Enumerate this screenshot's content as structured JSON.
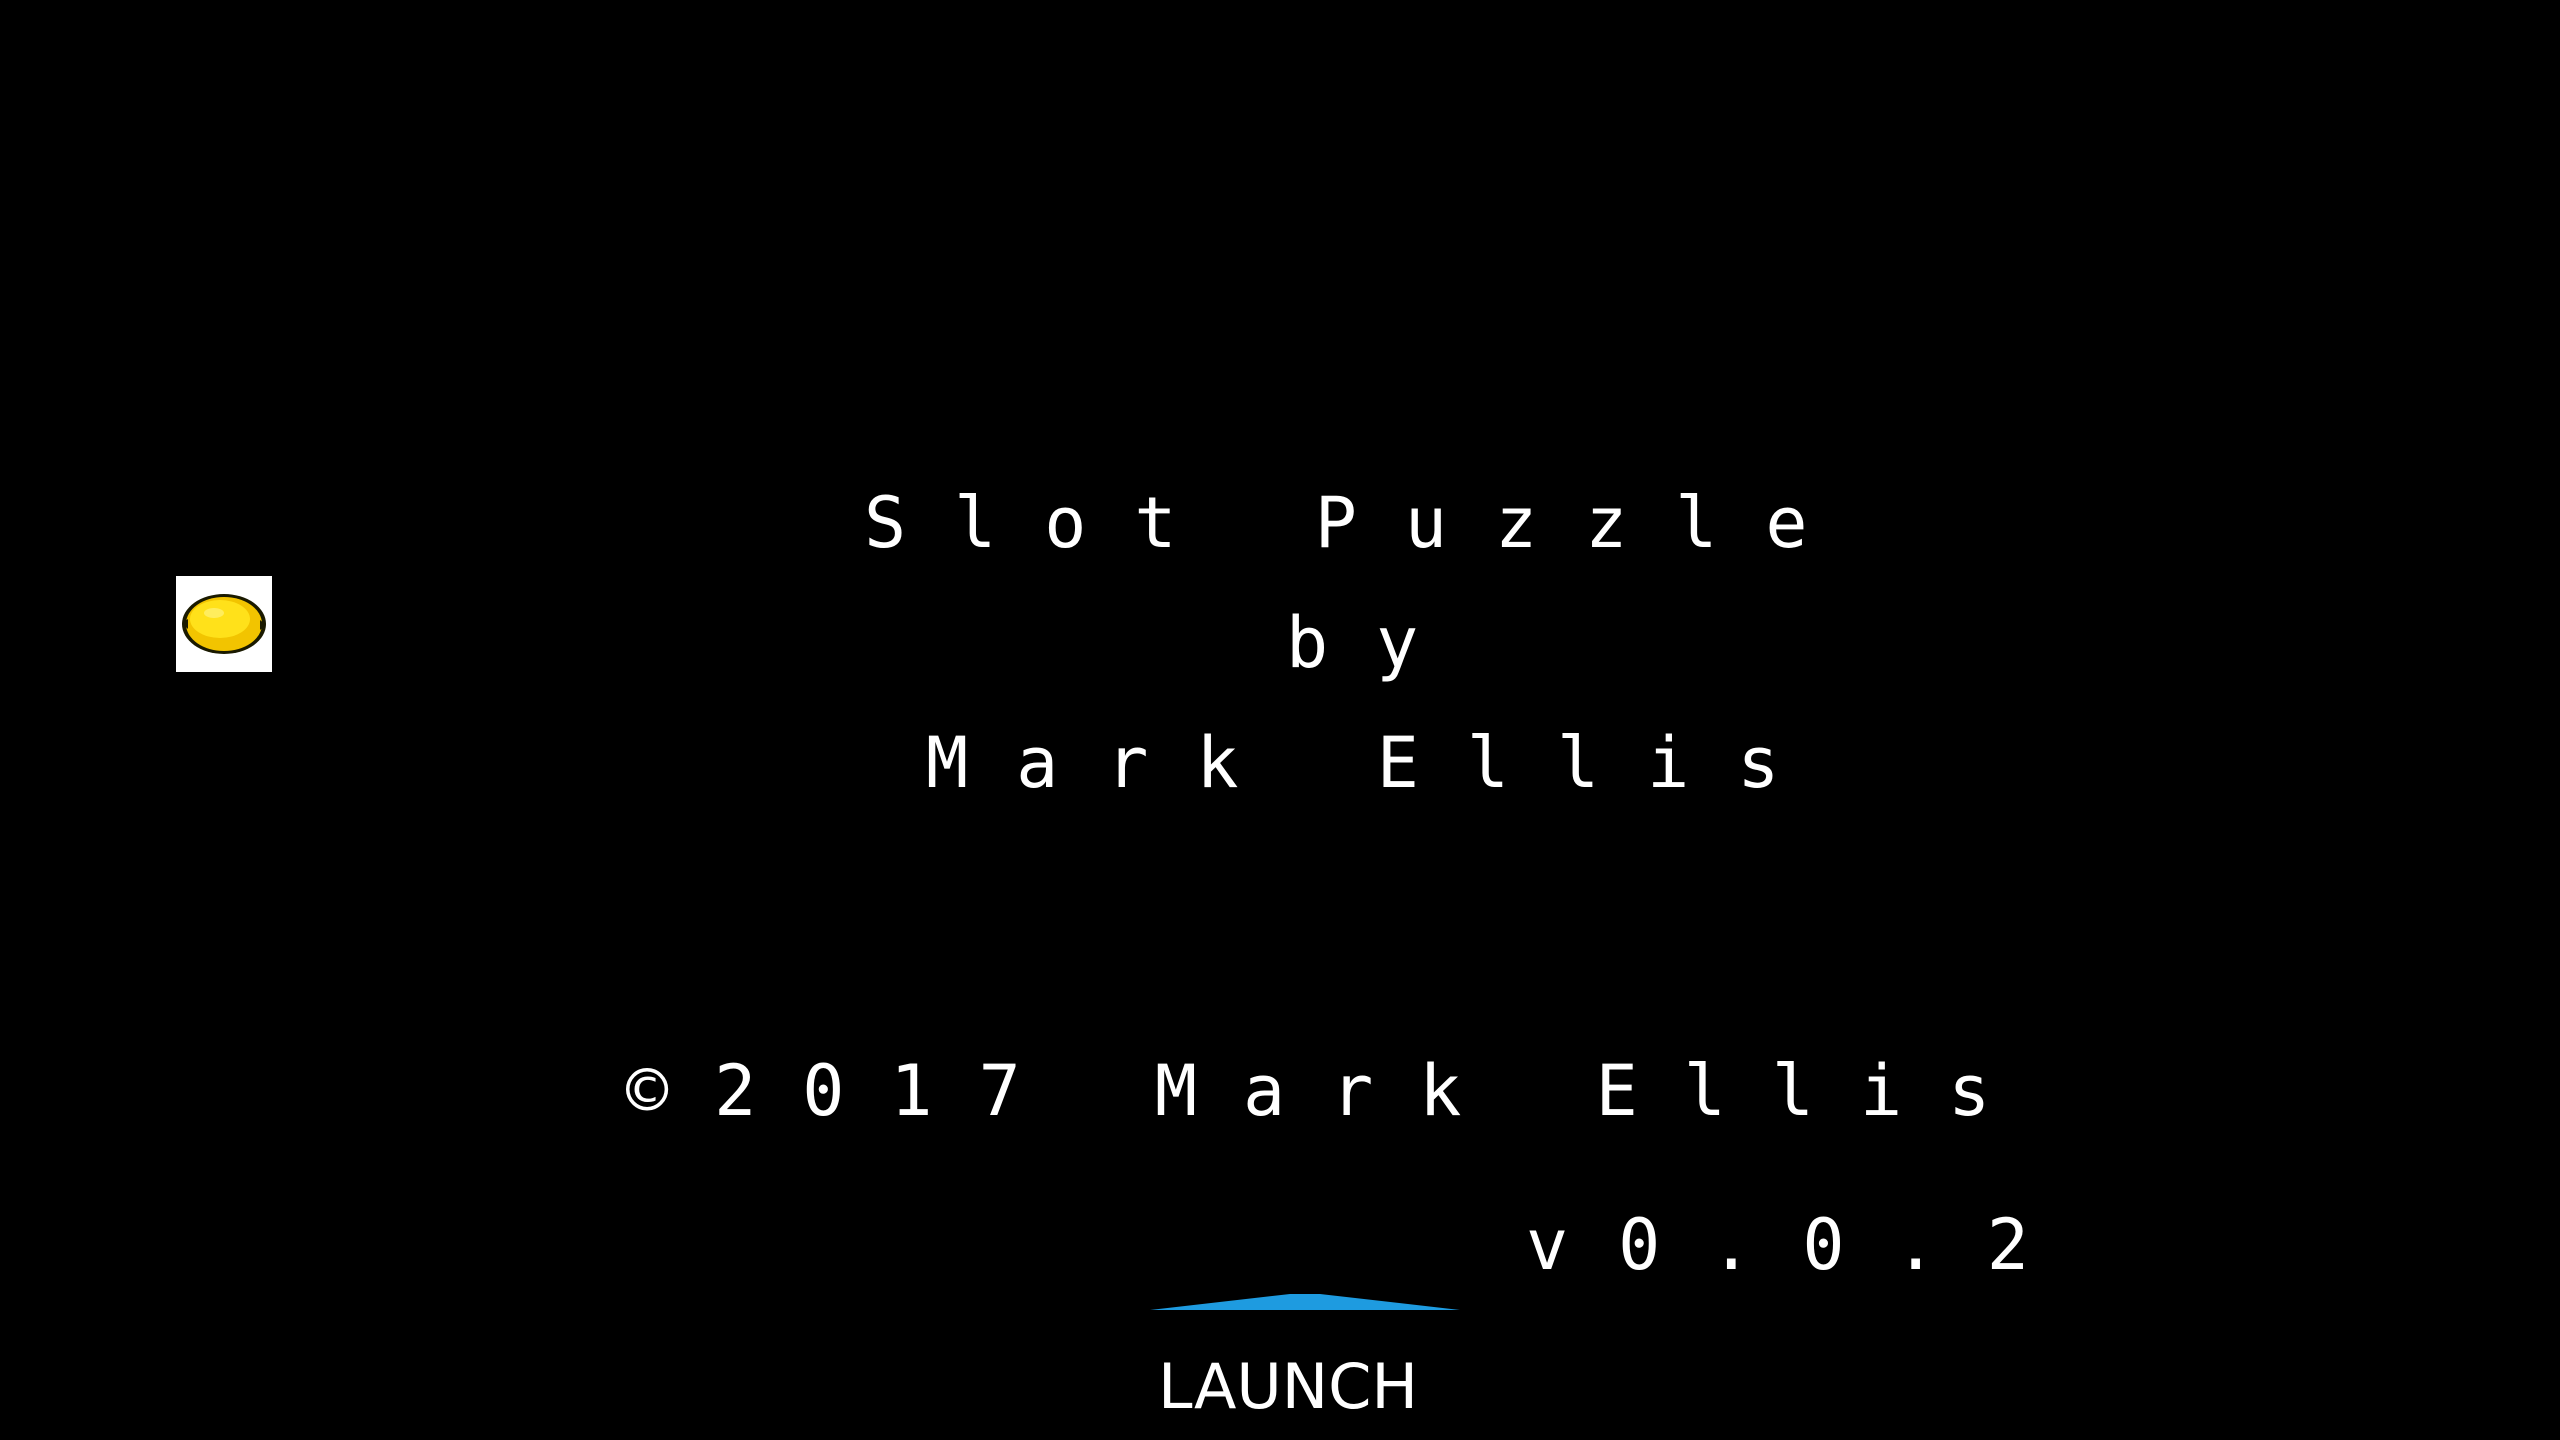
{
  "splash": {
    "title": "Slot Puzzle",
    "by": "by",
    "author": "Mark Ellis",
    "copyright": "©2017 Mark Ellis",
    "version": "v0.0.2"
  },
  "launch": {
    "label": "LAUNCH",
    "accent": "#1e9be0"
  },
  "icon": {
    "name": "lemon-icon",
    "fill": "#ffe11a",
    "tile": "#ffffff"
  }
}
